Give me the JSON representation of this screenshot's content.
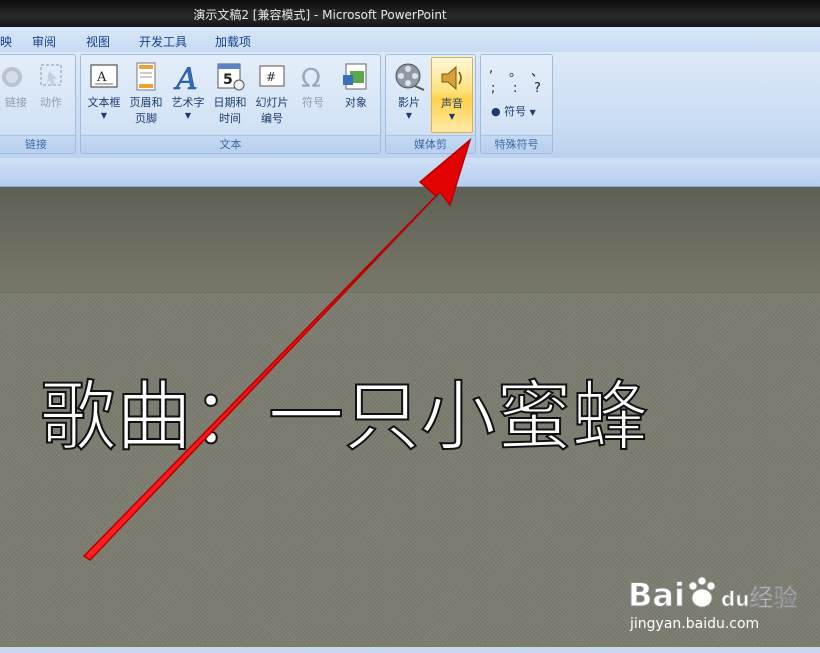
{
  "window": {
    "title": "演示文稿2 [兼容模式] - Microsoft PowerPoint"
  },
  "tabs": [
    "映",
    "审阅",
    "视图",
    "开发工具",
    "加载项"
  ],
  "groups": {
    "links": {
      "label": "链接",
      "buttons": [
        "链接",
        "动作"
      ]
    },
    "text": {
      "label": "文本",
      "buttons": [
        {
          "label": "文本框"
        },
        {
          "label": "页眉和",
          "label2": "页脚"
        },
        {
          "label": "艺术字"
        },
        {
          "label": "日期和",
          "label2": "时间"
        },
        {
          "label": "幻灯片",
          "label2": "编号"
        },
        {
          "label": "符号"
        },
        {
          "label": "对象"
        }
      ]
    },
    "media": {
      "label": "媒体剪",
      "buttons": [
        "影片",
        "声音"
      ]
    },
    "special": {
      "label": "特殊符号",
      "symbols": [
        ",",
        "。",
        "、",
        ";",
        ":",
        "?"
      ],
      "symbol_button": "符号"
    }
  },
  "slide": {
    "title": "歌曲：一只小蜜蜂"
  },
  "watermark": {
    "brand": "Bai",
    "brand2": "du",
    "jingyan": "经验",
    "url": "jingyan.baidu.com"
  },
  "colors": {
    "ribbon": "#d2e2f5",
    "accent_arrow": "#ff1a1a",
    "highlight": "#ffd24a"
  }
}
